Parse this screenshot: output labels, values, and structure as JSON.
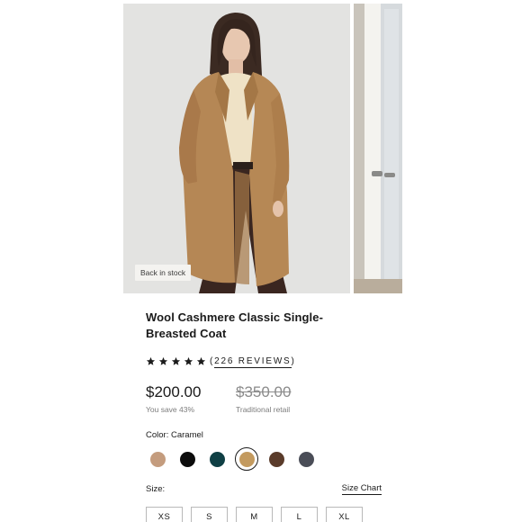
{
  "gallery": {
    "badge": "Back in stock"
  },
  "product": {
    "title": "Wool Cashmere Classic Single-Breasted Coat",
    "rating": {
      "stars": 5,
      "reviews_text": "226 REVIEWS",
      "open_paren": "(",
      "close_paren": ")"
    },
    "price": {
      "current": "$200.00",
      "savings": "You save 43%",
      "retail": "$350.00",
      "retail_label": "Traditional retail"
    },
    "color": {
      "label": "Color: Caramel",
      "swatches": [
        {
          "name": "swatch-camel",
          "hex": "#c49c7e",
          "selected": false
        },
        {
          "name": "swatch-black",
          "hex": "#0c0c0c",
          "selected": false
        },
        {
          "name": "swatch-teal",
          "hex": "#0f3f44",
          "selected": false
        },
        {
          "name": "swatch-caramel",
          "hex": "#c39a5f",
          "selected": true
        },
        {
          "name": "swatch-brown",
          "hex": "#5a3b2a",
          "selected": false
        },
        {
          "name": "swatch-charcoal",
          "hex": "#4a4d57",
          "selected": false
        }
      ]
    },
    "size": {
      "label": "Size:",
      "chart_link": "Size Chart",
      "options": [
        "XS",
        "S",
        "M",
        "L",
        "XL"
      ]
    }
  },
  "colors": {
    "star": "#1c1c1c",
    "text": "#1a1a1a",
    "muted": "#7c7c7c"
  }
}
